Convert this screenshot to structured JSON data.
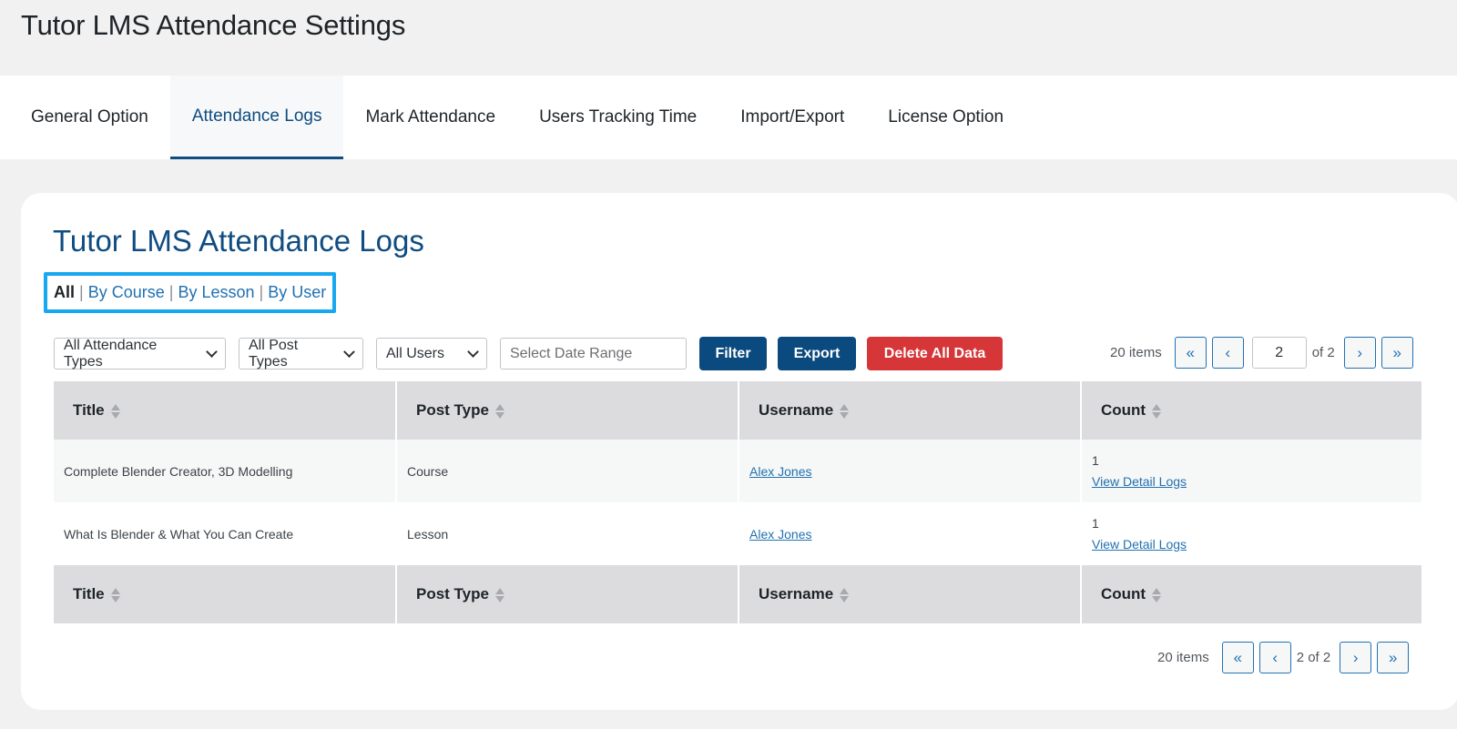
{
  "page_title": "Tutor LMS Attendance Settings",
  "tabs": [
    {
      "label": "General Option",
      "active": false
    },
    {
      "label": "Attendance Logs",
      "active": true
    },
    {
      "label": "Mark Attendance",
      "active": false
    },
    {
      "label": "Users Tracking Time",
      "active": false
    },
    {
      "label": "Import/Export",
      "active": false
    },
    {
      "label": "License Option",
      "active": false
    }
  ],
  "card": {
    "title": "Tutor LMS Attendance Logs",
    "views": {
      "all": "All",
      "by_course": "By Course",
      "by_lesson": "By Lesson",
      "by_user": "By User",
      "separator": "|"
    }
  },
  "filters": {
    "attendance_types": "All Attendance Types",
    "post_types": "All Post Types",
    "users": "All Users",
    "date_range_placeholder": "Select Date Range",
    "filter_label": "Filter",
    "export_label": "Export",
    "delete_label": "Delete All Data"
  },
  "pagination_top": {
    "items": "20 items",
    "first": "«",
    "prev": "‹",
    "current_page": "2",
    "of_total": "of 2",
    "next": "›",
    "last": "»"
  },
  "pagination_bottom": {
    "items": "20 items",
    "first": "«",
    "prev": "‹",
    "page_display": "2 of 2",
    "next": "›",
    "last": "»"
  },
  "table": {
    "columns": [
      "Title",
      "Post Type",
      "Username",
      "Count"
    ],
    "rows": [
      {
        "title": "Complete Blender Creator, 3D Modelling",
        "post_type": "Course",
        "username": "Alex Jones",
        "count": "1",
        "detail_link": "View Detail Logs"
      },
      {
        "title": "What Is Blender & What You Can Create",
        "post_type": "Lesson",
        "username": "Alex Jones",
        "count": "1",
        "detail_link": "View Detail Logs"
      }
    ]
  },
  "colors": {
    "primary": "#0b4a7e",
    "danger": "#d63638",
    "link": "#2271b1",
    "highlight_border": "#18a8f0"
  }
}
